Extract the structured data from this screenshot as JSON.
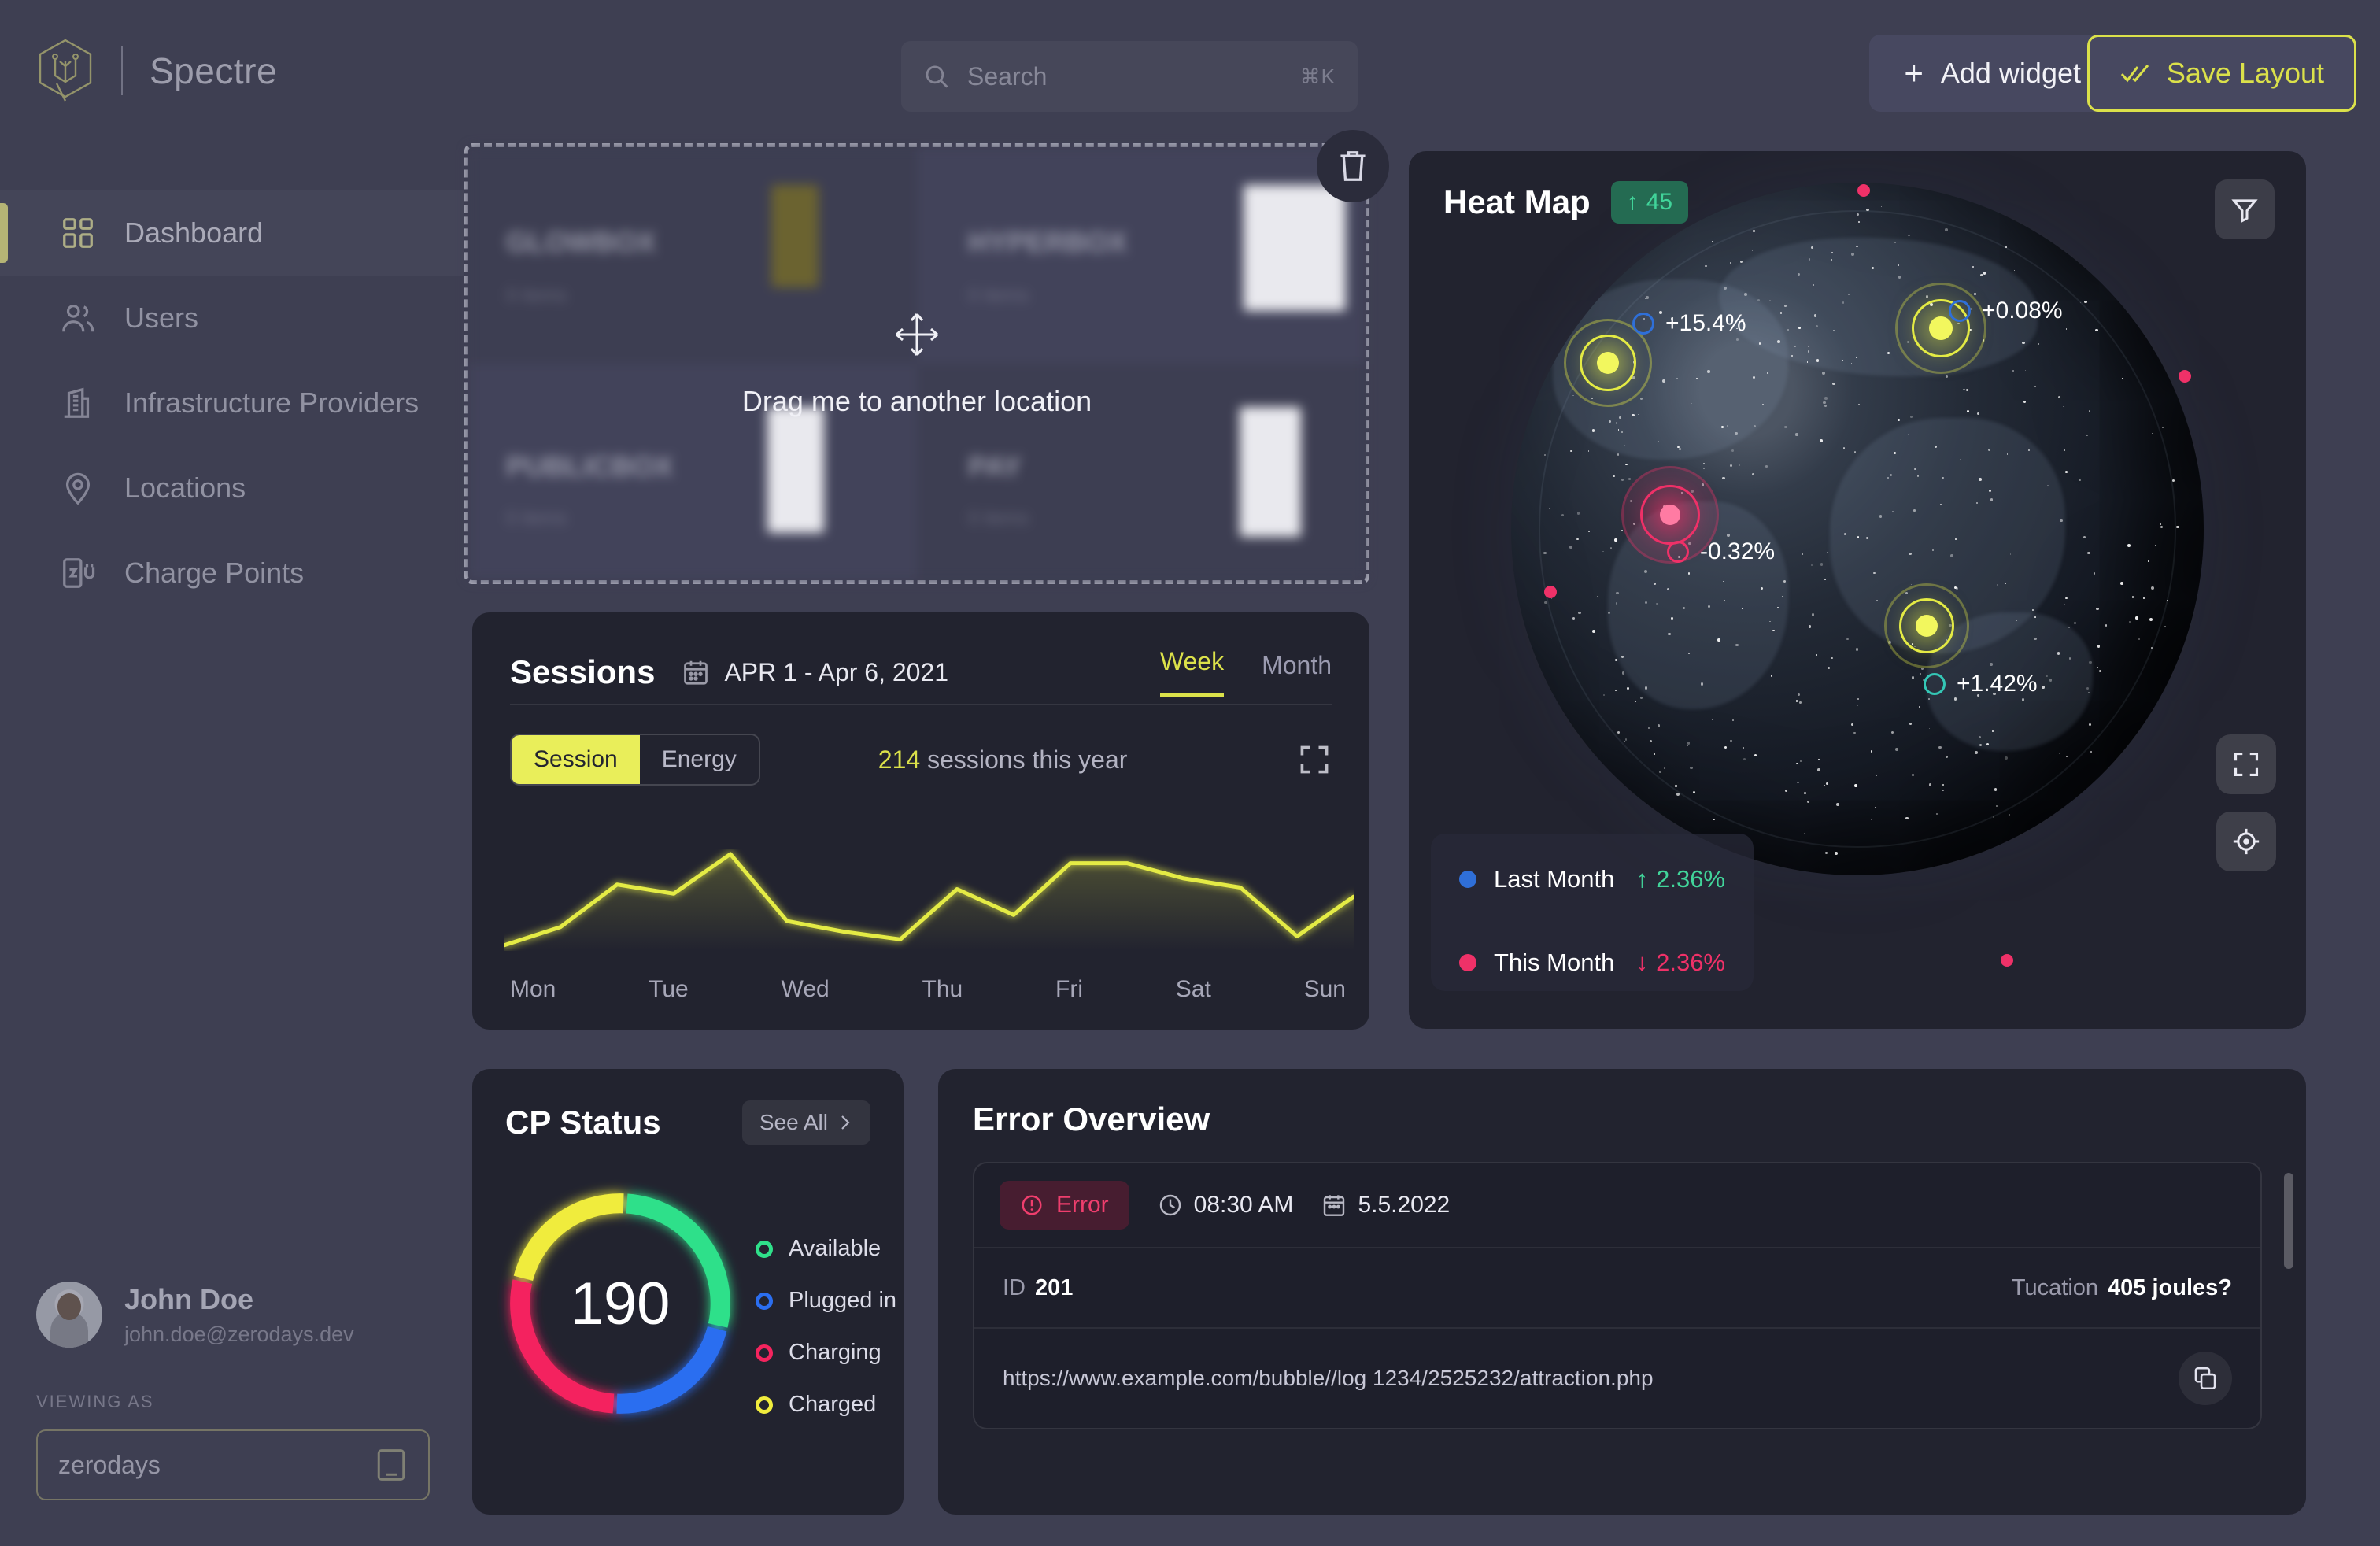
{
  "brand": {
    "name": "Spectre",
    "logo_icon": "hexagon-circuit-logo"
  },
  "sidebar": {
    "items": [
      {
        "label": "Dashboard",
        "icon": "grid-dashboard-icon",
        "active": true
      },
      {
        "label": "Users",
        "icon": "users-icon",
        "active": false
      },
      {
        "label": "Infrastructure Providers",
        "icon": "building-icon",
        "active": false
      },
      {
        "label": "Locations",
        "icon": "map-pin-icon",
        "active": false
      },
      {
        "label": "Charge Points",
        "icon": "charge-point-icon",
        "active": false
      }
    ],
    "user": {
      "name": "John Doe",
      "email": "john.doe@zerodays.dev",
      "viewing_as_label": "VIEWING AS",
      "viewing_as_value": "zerodays",
      "viewing_as_icon": "device-icon",
      "avatar_icon": "user-avatar"
    }
  },
  "topbar": {
    "search": {
      "placeholder": "Search",
      "shortcut": "⌘K",
      "icon": "search-icon"
    },
    "add_widget": {
      "label": "Add widget",
      "icon": "plus-icon"
    },
    "save_layout": {
      "label": "Save Layout",
      "icon": "double-check-icon",
      "accent": "#dbe14a"
    }
  },
  "drag_widget": {
    "message": "Drag me to another location",
    "move_icon": "move-arrows-icon",
    "delete_icon": "trash-icon",
    "ghost_cards": [
      {
        "title": "GLOWBOX",
        "subtitle": "0 items"
      },
      {
        "title": "HYPERBOX",
        "subtitle": "0 items"
      },
      {
        "title": "PUBLICBOX",
        "subtitle": "0 items"
      },
      {
        "title": "PAY",
        "subtitle": "0 items"
      }
    ]
  },
  "sessions": {
    "title": "Sessions",
    "calendar_icon": "calendar-icon",
    "date_range": "APR 1 - Apr 6, 2021",
    "tabs": [
      {
        "label": "Week",
        "active": true
      },
      {
        "label": "Month",
        "active": false
      }
    ],
    "toggle": [
      {
        "label": "Session",
        "active": true
      },
      {
        "label": "Energy",
        "active": false
      }
    ],
    "count_value": "214",
    "count_suffix": " sessions this year",
    "expand_icon": "expand-icon"
  },
  "heat_map": {
    "title": "Heat Map",
    "badge": {
      "arrow": "↑",
      "value": "45",
      "color": "#41d49a"
    },
    "filter_icon": "filter-icon",
    "fullscreen_icon": "fullscreen-icon",
    "locate_icon": "crosshair-locate-icon",
    "points": [
      {
        "label": "+15.4%",
        "marker_color": "#2f6fd8",
        "hotspot_color": "#e4eb45"
      },
      {
        "label": "+0.08%",
        "marker_color": "#2f6fd8",
        "hotspot_color": "#e4eb45"
      },
      {
        "label": "-0.32%",
        "marker_color": "#ef3168",
        "hotspot_color": "#ef3168"
      },
      {
        "label": "+1.42%",
        "marker_color": "#34c7b6",
        "hotspot_color": "#e4eb45"
      }
    ],
    "legend": [
      {
        "label": "Last Month",
        "dot_color": "#2f6fd8",
        "arrow": "↑",
        "value": "2.36%",
        "value_color": "#41d49a"
      },
      {
        "label": "This Month",
        "dot_color": "#ef3168",
        "arrow": "↓",
        "value": "2.36%",
        "value_color": "#ef3168"
      }
    ]
  },
  "cp_status": {
    "title": "CP Status",
    "see_all": "See All",
    "chevron_icon": "chevron-right-icon",
    "total": "190",
    "legend": [
      {
        "label": "Available",
        "color": "#2fe08a"
      },
      {
        "label": "Plugged in",
        "color": "#2b6ef0"
      },
      {
        "label": "Charging",
        "color": "#f4245e"
      },
      {
        "label": "Charged",
        "color": "#f0ec3d"
      }
    ]
  },
  "error_overview": {
    "title": "Error Overview",
    "badge": {
      "label": "Error",
      "icon": "alert-circle-icon",
      "color": "#ef3e6d"
    },
    "time": "08:30 AM",
    "time_icon": "clock-icon",
    "date": "5.5.2022",
    "date_icon": "calendar-icon",
    "id_label": "ID",
    "id_value": "201",
    "metric_label": "Tucation",
    "metric_value": "405 joules?",
    "url": "https://www.example.com/bubble//log 1234/2525232/attraction.php",
    "copy_icon": "copy-icon"
  },
  "chart_data": [
    {
      "type": "line",
      "title": "Sessions",
      "xlabel": "",
      "ylabel": "",
      "categories": [
        "Mon",
        "Tue",
        "Wed",
        "Thu",
        "Fri",
        "Sat",
        "Sun"
      ],
      "x": [
        0,
        1,
        2,
        3,
        4,
        5,
        6,
        7,
        8,
        9,
        10,
        11,
        12,
        13,
        14,
        15
      ],
      "values": [
        18,
        30,
        58,
        52,
        78,
        34,
        27,
        22,
        55,
        38,
        72,
        72,
        62,
        56,
        24,
        50
      ],
      "ylim": [
        0,
        100
      ],
      "grid": false,
      "legend": "none",
      "line_color": "#e4eb45"
    },
    {
      "type": "pie",
      "title": "CP Status",
      "center_label": "190",
      "categories": [
        "Available",
        "Plugged in",
        "Charging",
        "Charged"
      ],
      "values": [
        28,
        22,
        28,
        22
      ],
      "colors": [
        "#2fe08a",
        "#2b6ef0",
        "#f4245e",
        "#f0ec3d"
      ],
      "legend": "right"
    }
  ]
}
